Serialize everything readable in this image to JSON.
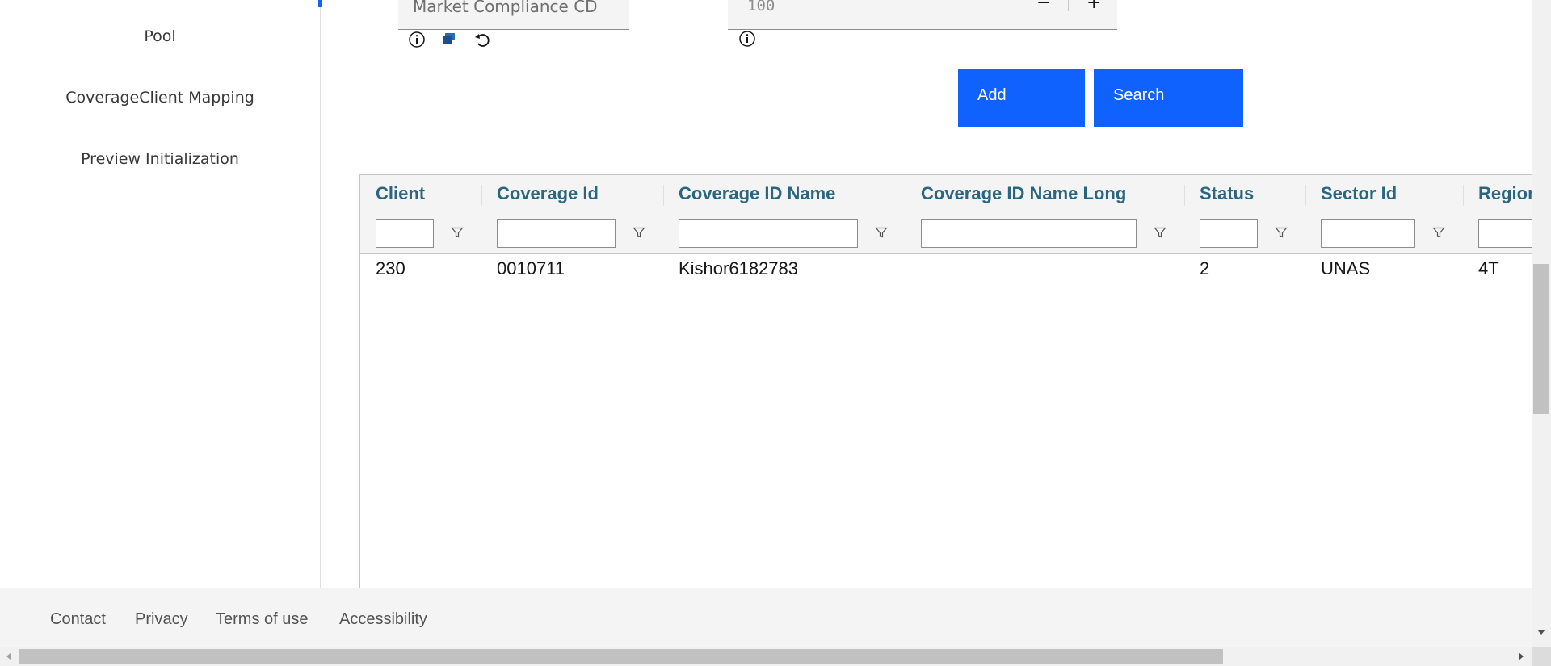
{
  "sidebar": {
    "items": [
      {
        "label": "Pool"
      },
      {
        "label": "CoverageClient Mapping"
      },
      {
        "label": "Preview Initialization"
      }
    ]
  },
  "form": {
    "compliance_field": {
      "value": "Market Compliance CD"
    },
    "number_field": {
      "value": "100",
      "decrement_label": "−",
      "increment_label": "+"
    }
  },
  "actions": {
    "add_label": "Add",
    "search_label": "Search"
  },
  "table": {
    "columns": [
      {
        "label": "Client"
      },
      {
        "label": "Coverage Id"
      },
      {
        "label": "Coverage ID Name"
      },
      {
        "label": "Coverage ID Name Long"
      },
      {
        "label": "Status"
      },
      {
        "label": "Sector Id"
      },
      {
        "label": "Region"
      }
    ],
    "rows": [
      {
        "client": "230",
        "coverage_id": "0010711",
        "coverage_id_name": "Kishor6182783",
        "coverage_id_name_long": "",
        "status": "2",
        "sector_id": "UNAS",
        "region": "4T"
      }
    ]
  },
  "footer": {
    "links": [
      {
        "label": "Contact"
      },
      {
        "label": "Privacy"
      },
      {
        "label": "Terms of use"
      },
      {
        "label": "Accessibility"
      }
    ]
  },
  "colors": {
    "primary": "#0f62fe",
    "header_text": "#2b6680",
    "footer_bg": "#f4f4f4"
  }
}
